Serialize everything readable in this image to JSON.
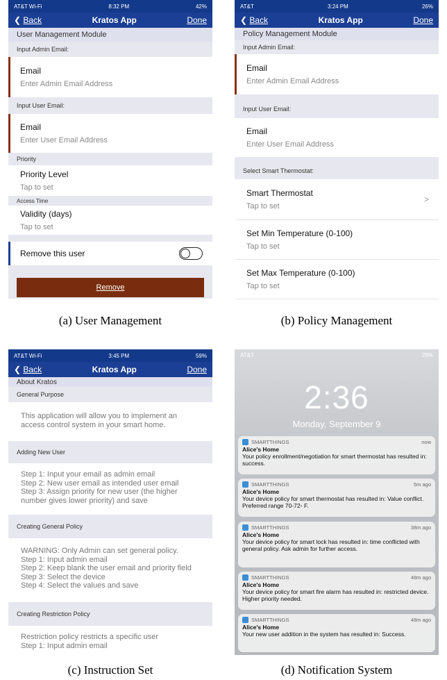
{
  "captions": {
    "a": "(a) User Management",
    "b": "(b) Policy Management",
    "c": "(c) Instruction Set",
    "d": "(d) Notification System"
  },
  "common": {
    "back_label": "Back",
    "app_title": "Kratos App",
    "done_label": "Done"
  },
  "panel_a": {
    "status": {
      "carrier": "AT&T Wi-Fi",
      "time": "8:32 PM",
      "battery": "42%"
    },
    "module": "User Management Module",
    "sec_admin": "Input Admin Email:",
    "admin_title": "Email",
    "admin_placeholder": "Enter Admin Email Address",
    "sec_user": "Input User Email:",
    "user_title": "Email",
    "user_placeholder": "Enter User Email Address",
    "sec_priority": "Priority",
    "priority_title": "Priority Level",
    "priority_value": "Tap to set",
    "sec_access": "Access Time",
    "validity_title": "Validity (days)",
    "validity_value": "Tap to set",
    "remove_toggle_label": "Remove this user",
    "remove_button": "Remove"
  },
  "panel_b": {
    "status": {
      "carrier": "AT&T",
      "time": "3:24 PM",
      "battery": "26%"
    },
    "module": "Policy Management Module",
    "sec_admin": "Input Admin Email:",
    "admin_title": "Email",
    "admin_placeholder": "Enter Admin Email Address",
    "sec_user": "Input User Email:",
    "user_title": "Email",
    "user_placeholder": "Enter User Email Address",
    "sec_thermo": "Select Smart Thermostat:",
    "thermo_title": "Smart Thermostat",
    "thermo_value": "Tap to set",
    "min_title": "Set Min Temperature (0-100)",
    "min_value": "Tap to set",
    "max_title": "Set Max Temperature (0-100)",
    "max_value": "Tap to set"
  },
  "panel_c": {
    "status": {
      "carrier": "AT&T Wi-Fi",
      "time": "3:45 PM",
      "battery": "59%"
    },
    "about": "About Kratos",
    "sec_general": "General Purpose",
    "general_text": "This application will allow you to implement an access control system in your smart home.",
    "sec_adding": "Adding New User",
    "adding_text": "Step 1: Input your email as admin email\nStep 2: New user email as intended user email\nStep 3: Assign priority for new user (the higher number gives lower priority) and save",
    "sec_creating": "Creating General Policy",
    "creating_text": "WARNING: Only Admin can set general policy.\nStep 1: Input admin email\nStep 2: Keep blank the user email and priority field\nStep 3: Select the device\n Step 4: Select the values and save",
    "sec_restriction": "Creating Restriction Policy",
    "restriction_text": "Restriction policy restricts a specific user\nStep 1: Input admin email"
  },
  "panel_d": {
    "status": {
      "carrier": "AT&T",
      "battery": "29%"
    },
    "time": "2:36",
    "date": "Monday, September 9",
    "notifications": [
      {
        "app": "SMARTTHINGS",
        "ago": "now",
        "title": "Alice's Home",
        "body": "Your policy enrollment/negotiation for smart thermostat has resulted in: success."
      },
      {
        "app": "SMARTTHINGS",
        "ago": "5m ago",
        "title": "Alice's Home",
        "body": "Your device policy for smart thermostat has resulted in: Value conflict. Preferred range 70-72◦ F."
      },
      {
        "app": "SMARTTHINGS",
        "ago": "38m ago",
        "title": "Alice's Home",
        "body": "Your device policy for smart lock has resulted in: time conflicted with general policy. Ask admin for further access."
      },
      {
        "app": "SMARTTHINGS",
        "ago": "48m ago",
        "title": "Alice's Home",
        "body": "Your device policy for smart fire alarm has resulted in: restricted device. Higher priority needed."
      },
      {
        "app": "SMARTTHINGS",
        "ago": "48m ago",
        "title": "Alice's Home",
        "body": "Your new user addition in the system has resulted in: Success."
      }
    ]
  }
}
